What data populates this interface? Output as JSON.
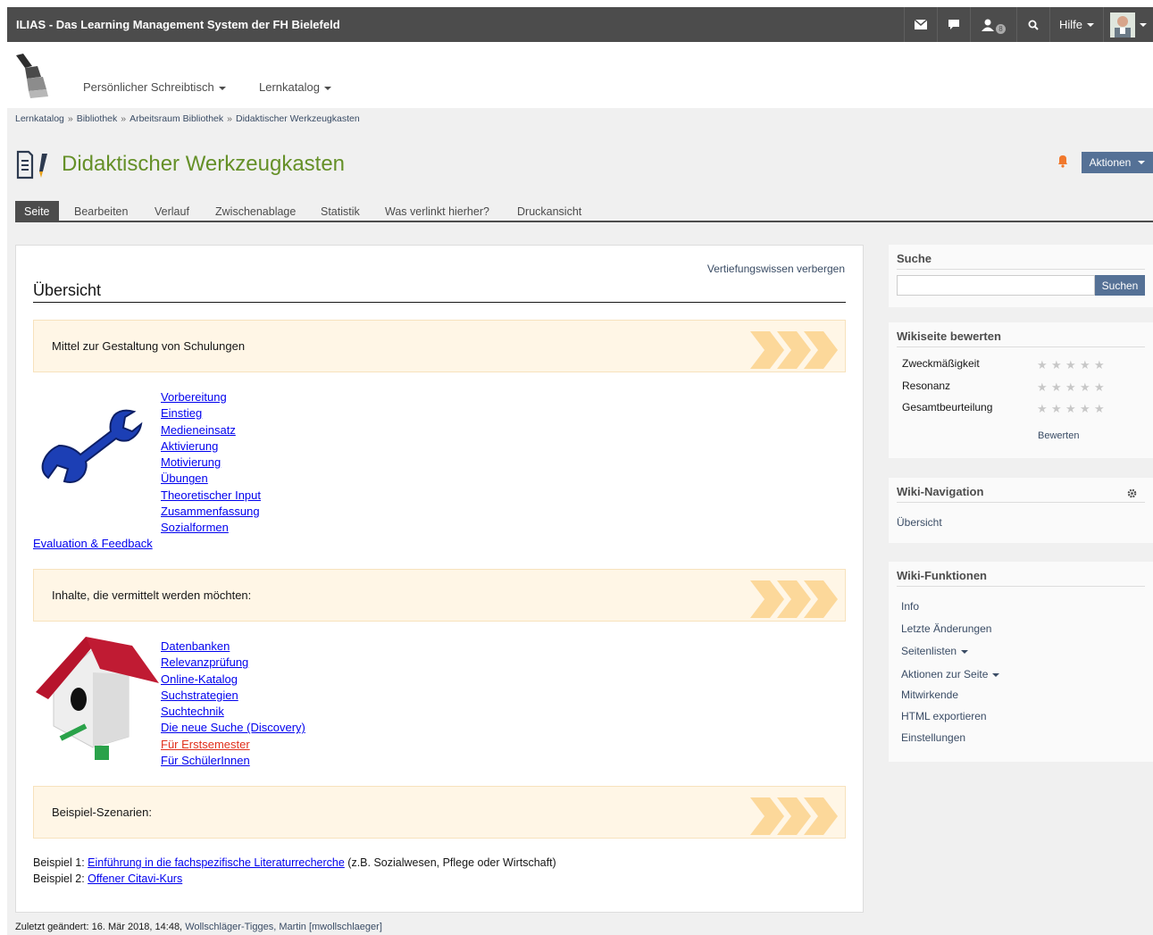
{
  "topbar": {
    "title": "ILIAS - Das Learning Management System der FH Bielefeld",
    "help_label": "Hilfe",
    "contacts_badge": "8"
  },
  "mainmenu": {
    "desk": "Persönlicher Schreibtisch",
    "catalog": "Lernkatalog"
  },
  "breadcrumb": [
    "Lernkatalog",
    "Bibliothek",
    "Arbeitsraum Bibliothek",
    "Didaktischer Werkzeugkasten"
  ],
  "breadcrumb_sep": "»",
  "page": {
    "title": "Didaktischer Werkzeugkasten",
    "actions_label": "Aktionen"
  },
  "tabs": [
    "Seite",
    "Bearbeiten",
    "Verlauf",
    "Zwischenablage",
    "Statistik",
    "Was verlinkt hierher?",
    "Druckansicht"
  ],
  "content": {
    "toggle_link": "Vertiefungswissen verbergen",
    "heading": "Übersicht",
    "band1": "Mittel zur Gestaltung von Schulungen",
    "links1": [
      "Vorbereitung",
      "Einstieg",
      "Medieneinsatz",
      "Aktivierung",
      "Motivierung",
      "Übungen",
      "Theoretischer Input",
      "Zusammenfassung",
      "Sozialformen"
    ],
    "eval_link": "Evaluation & Feedback",
    "band2": "Inhalte, die vermittelt werden möchten:",
    "links2": [
      "Datenbanken",
      "Relevanzprüfung",
      "Online-Katalog",
      "Suchstrategien",
      "Suchtechnik",
      "Die neue Suche (Discovery)",
      "Für Erstsemester",
      "Für SchülerInnen"
    ],
    "band3": "Beispiel-Szenarien:",
    "example1_prefix": "Beispiel 1: ",
    "example1_link": "Einführung in die fachspezifische Literaturrecherche",
    "example1_suffix": " (z.B. Sozialwesen, Pflege oder Wirtschaft)",
    "example2_prefix": "Beispiel 2: ",
    "example2_link": "Offener Citavi-Kurs"
  },
  "footer": {
    "changed_prefix": "Zuletzt geändert: 16. Mär 2018, 14:48, ",
    "changed_user": "Wollschläger-Tigges, Martin [mwollschlaeger]"
  },
  "sidebar": {
    "search_title": "Suche",
    "search_button": "Suchen",
    "rate_title": "Wikiseite bewerten",
    "rate_rows": [
      "Zweckmäßigkeit",
      "Resonanz",
      "Gesamtbeurteilung"
    ],
    "rate_button": "Bewerten",
    "nav_title": "Wiki-Navigation",
    "nav_link": "Übersicht",
    "fn_title": "Wiki-Funktionen",
    "fn_items": [
      "Info",
      "Letzte Änderungen",
      "Seitenlisten",
      "Aktionen zur Seite",
      "Mitwirkende",
      "HTML exportieren",
      "Einstellungen"
    ]
  },
  "colors": {
    "topbar": "#4c4c4c",
    "title_green": "#659028",
    "action_blue": "#557196",
    "band_bg": "#fff6e6",
    "chevron": "#fcd89a"
  }
}
